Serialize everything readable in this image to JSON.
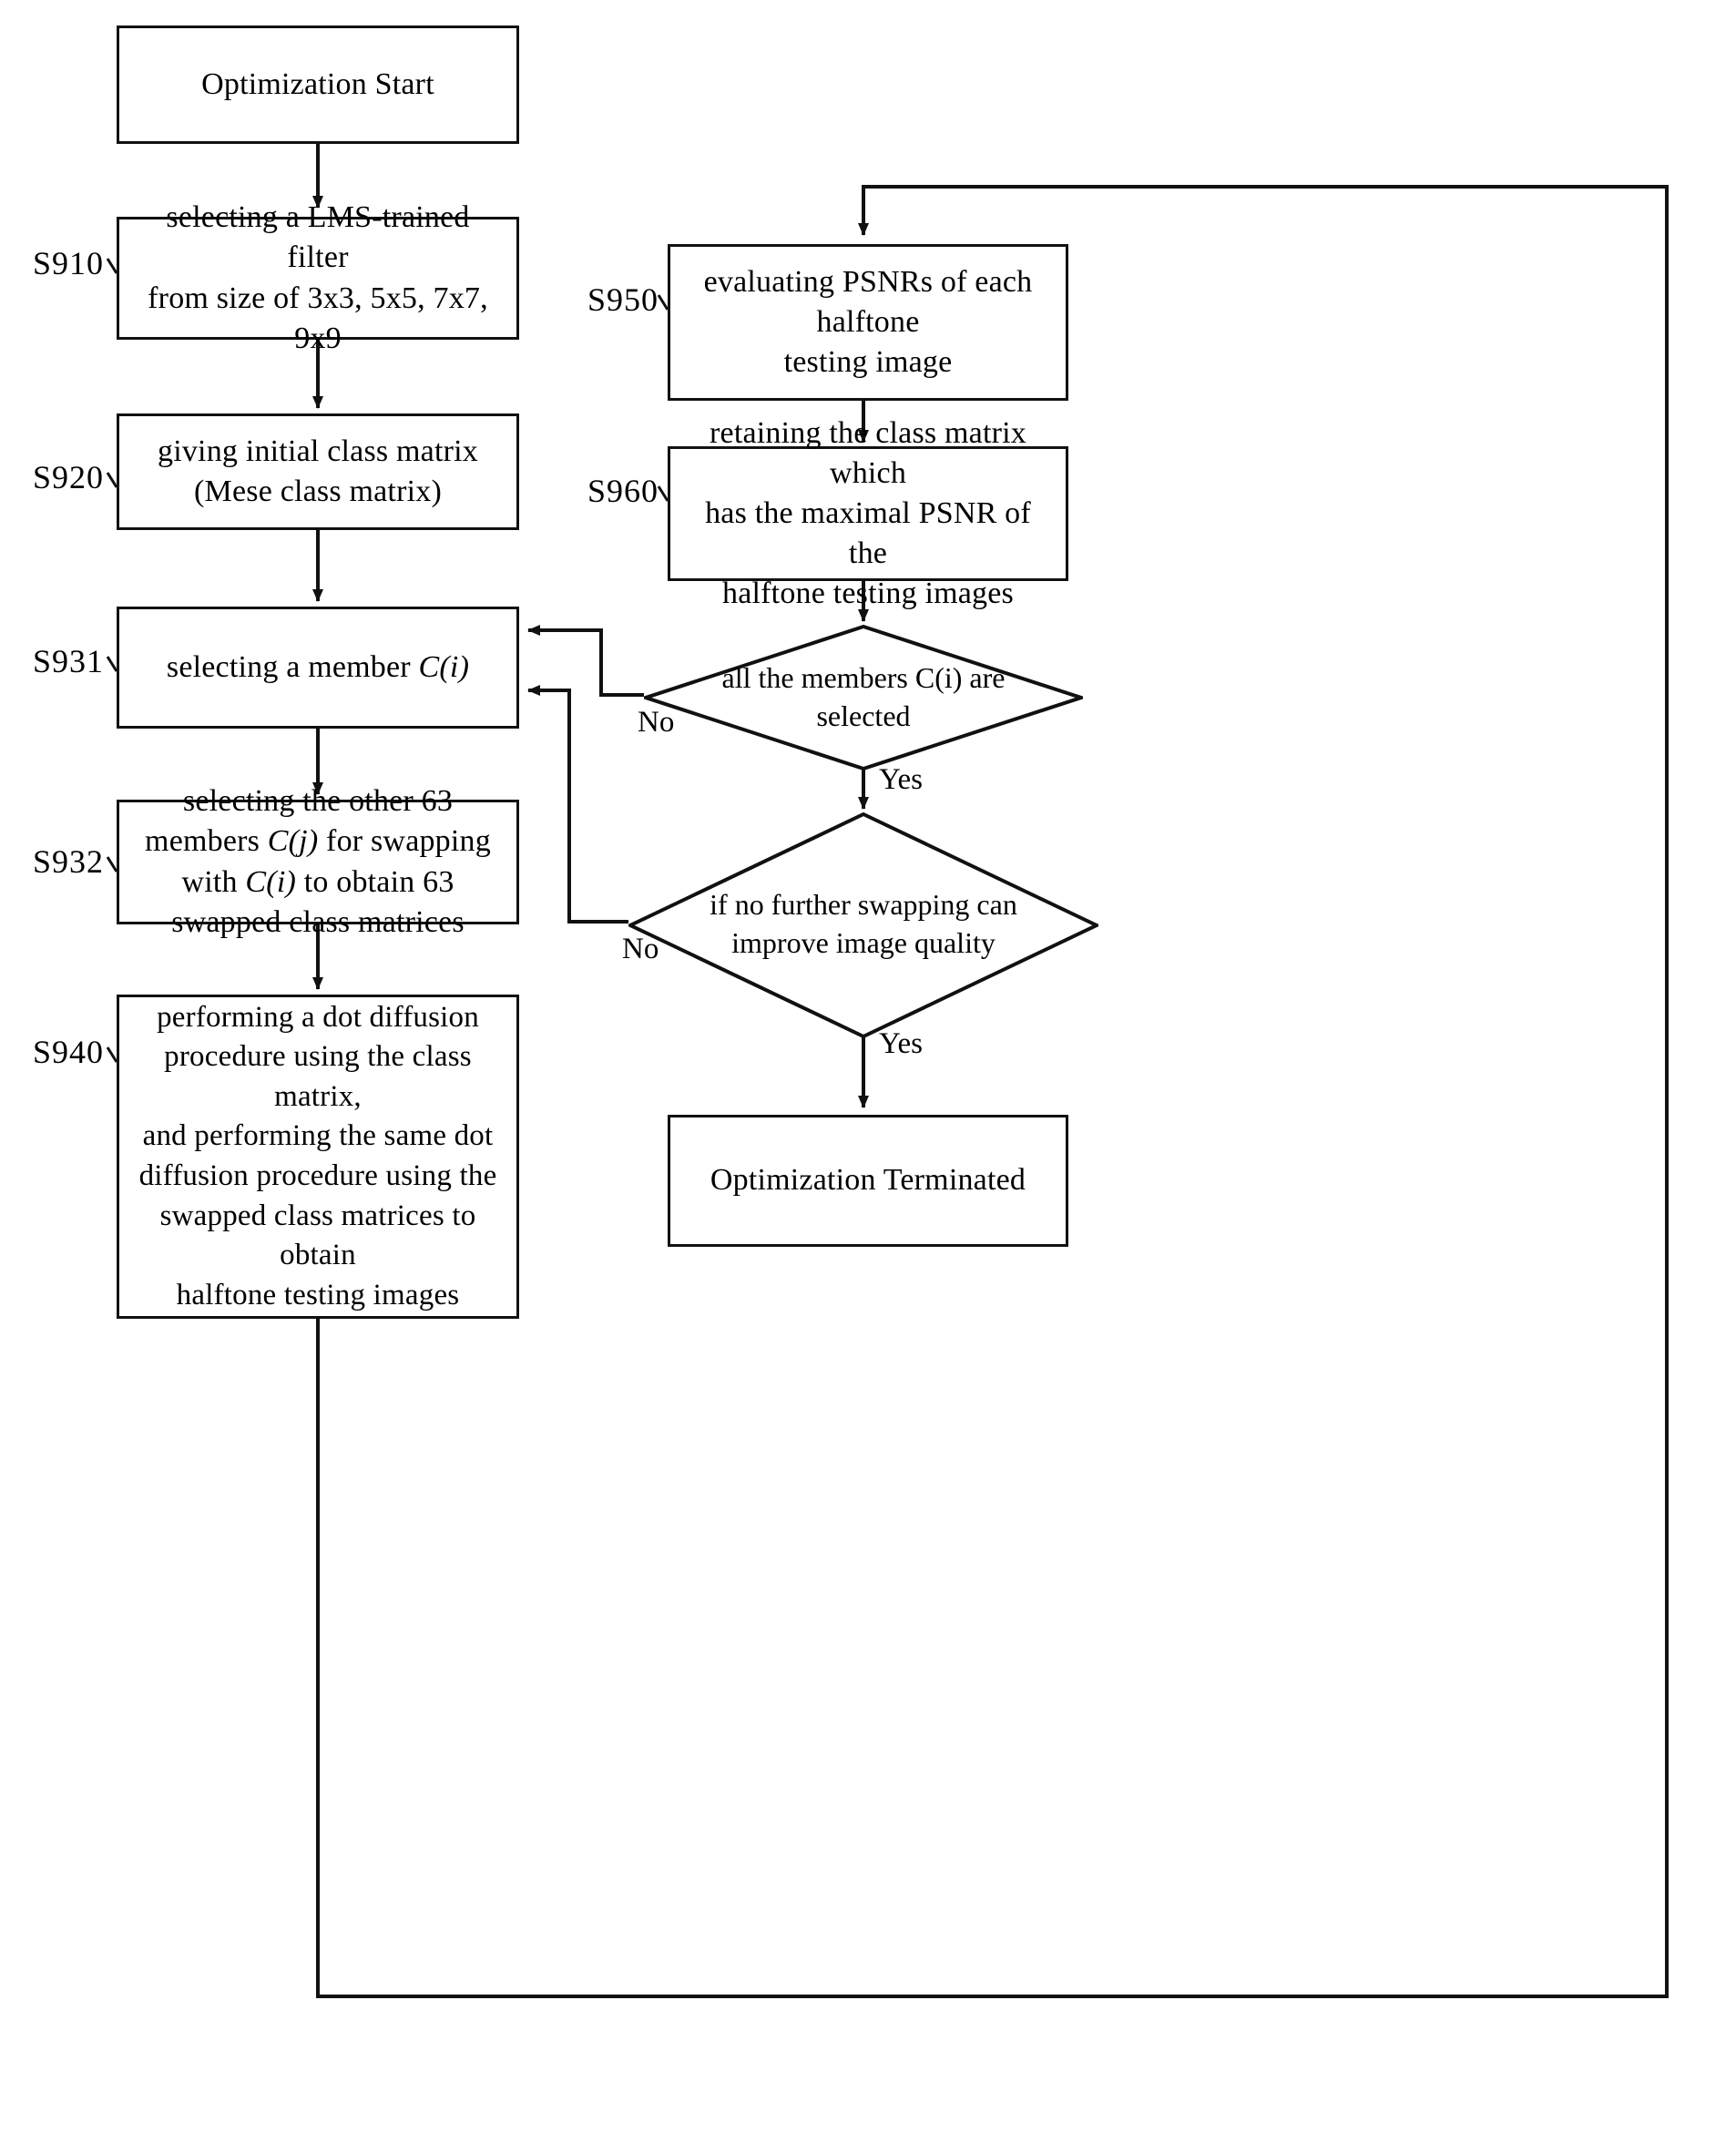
{
  "figure": {
    "type": "flowchart",
    "orientation": "two-column",
    "title": "Optimization Start"
  },
  "nodes": {
    "start": {
      "shape": "process",
      "text": "Optimization Start"
    },
    "s910": {
      "step_label": "S910",
      "shape": "process",
      "line1": "selecting a LMS-trained filter",
      "line2": "from size of 3x3, 5x5, 7x7, 9x9"
    },
    "s920": {
      "step_label": "S920",
      "shape": "process",
      "line1": "giving initial class matrix",
      "line2": "(Mese class matrix)"
    },
    "s931": {
      "step_label": "S931",
      "shape": "process",
      "text_plain": "selecting a member ",
      "text_italic": "C(i)"
    },
    "s932": {
      "step_label": "S932",
      "shape": "process",
      "seg1": "selecting the other 63 members ",
      "seg2": "C(j)",
      "seg3": " for swapping  with ",
      "seg4": "C(i)",
      "seg5": " to obtain 63 swapped class matrices"
    },
    "s940": {
      "step_label": "S940",
      "shape": "process",
      "line1": "performing a dot diffusion",
      "line2": "procedure using the class matrix,",
      "line3": "and performing the same dot",
      "line4": "diffusion procedure using the",
      "line5": "swapped class matrices to obtain",
      "line6": "halftone testing images"
    },
    "s950": {
      "step_label": "S950",
      "shape": "process",
      "line1": "evaluating PSNRs of each halftone",
      "line2": "testing image"
    },
    "s960": {
      "step_label": "S960",
      "shape": "process",
      "line1": "retaining the class matrix which",
      "line2": "has the maximal PSNR of the",
      "line3": "halftone testing images"
    },
    "decision_members": {
      "shape": "decision",
      "line1": "all the members C(i) are",
      "line2": "selected",
      "branch_no": "No",
      "branch_yes": "Yes"
    },
    "decision_swapping": {
      "shape": "decision",
      "line1": "if no further swapping can",
      "line2": "improve image quality",
      "branch_no": "No",
      "branch_yes": "Yes"
    },
    "end": {
      "shape": "process",
      "text": "Optimization Terminated"
    }
  },
  "colors": {
    "stroke": "#111111",
    "background": "#ffffff",
    "text": "#000000"
  }
}
